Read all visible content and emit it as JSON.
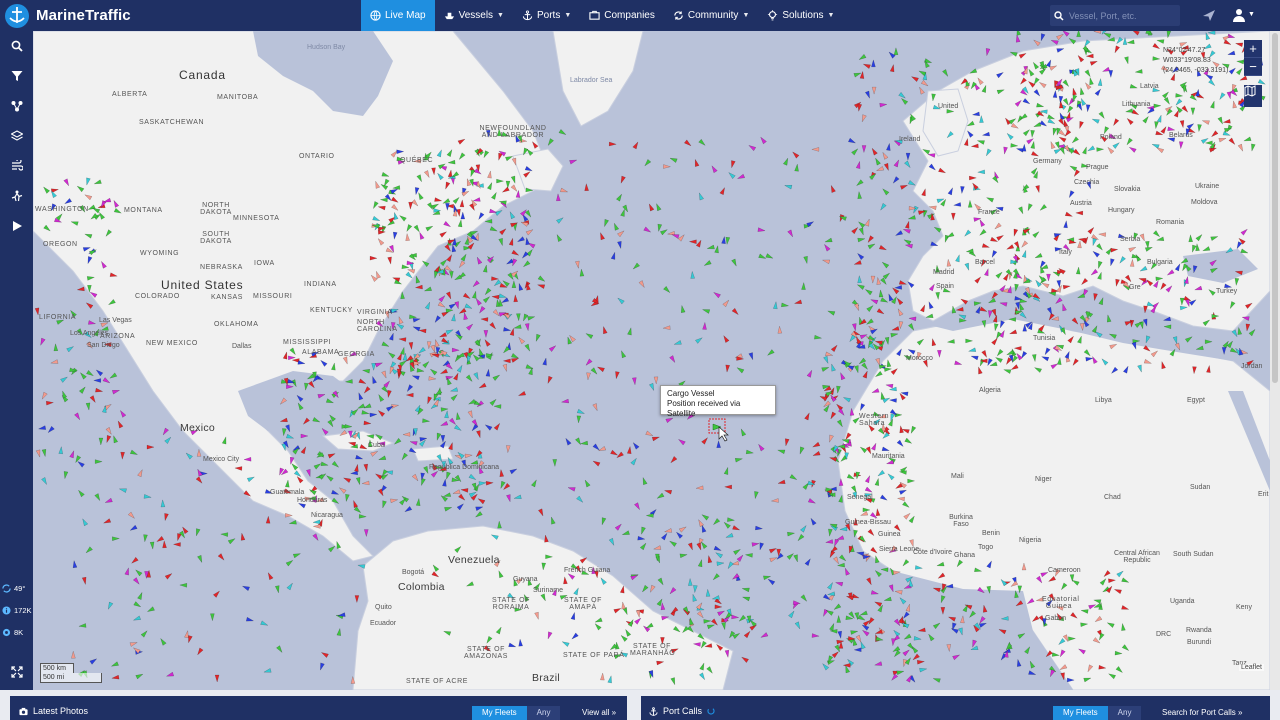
{
  "app": {
    "brand": "MarineTraffic"
  },
  "nav": {
    "items": [
      {
        "label": "Live Map",
        "icon": "globe-icon",
        "active": true,
        "caret": false
      },
      {
        "label": "Vessels",
        "icon": "ship-icon",
        "active": false,
        "caret": true
      },
      {
        "label": "Ports",
        "icon": "anchor-icon",
        "active": false,
        "caret": true
      },
      {
        "label": "Companies",
        "icon": "companies-icon",
        "active": false,
        "caret": false
      },
      {
        "label": "Community",
        "icon": "community-icon",
        "active": false,
        "caret": true
      },
      {
        "label": "Solutions",
        "icon": "bulb-icon",
        "active": false,
        "caret": true
      }
    ]
  },
  "search": {
    "placeholder": "Vessel, Port, etc."
  },
  "sidebar": {
    "tools": [
      "search-icon",
      "filter-icon",
      "share-icon",
      "layers-icon",
      "wind-icon",
      "measure-icon",
      "play-icon"
    ],
    "stats": [
      {
        "icon": "weather-icon",
        "value": "49°"
      },
      {
        "icon": "info-icon",
        "value": "172K"
      },
      {
        "icon": "settings-icon",
        "value": "8K"
      }
    ]
  },
  "map": {
    "tooltip": {
      "line1": "Cargo Vessel",
      "line2": "Position received via Satellite"
    },
    "coordinates": {
      "lat": "N24°02'47.27",
      "lon": "W033°19'08.83",
      "decimal": "(24.0465, -033.3191)"
    },
    "scale": {
      "km": "500 km",
      "mi": "500 mi"
    },
    "attribution": "Leaflet",
    "zoom_in": "+",
    "zoom_out": "−",
    "labels": {
      "canada": "Canada",
      "united_states": "United States",
      "mexico": "Mexico",
      "venezuela": "Venezuela",
      "colombia": "Colombia",
      "brazil": "Brazil",
      "guyana": "Guyana",
      "suriname": "Suriname",
      "french_guiana": "French Guiana",
      "ecuador": "Ecuador",
      "cuba": "Cuba",
      "honduras": "Honduras",
      "nicaragua": "Nicaragua",
      "guatemala": "Guatemala",
      "dominican": "República Dominicana",
      "hudson_bay": "Hudson Bay",
      "labrador_sea": "Labrador Sea",
      "alberta": "ALBERTA",
      "saskatchewan": "SASKATCHEWAN",
      "manitoba": "MANITOBA",
      "ontario": "ONTARIO",
      "quebec": "QUÉBEC",
      "newfoundland": "NEWFOUNDLAND AND LABRADOR",
      "washington": "WASHINGTON",
      "oregon": "OREGON",
      "montana": "MONTANA",
      "wyoming": "WYOMING",
      "north_dakota": "NORTH DAKOTA",
      "south_dakota": "SOUTH DAKOTA",
      "nebraska": "NEBRASKA",
      "colorado": "COLORADO",
      "kansas": "KANSAS",
      "oklahoma": "OKLAHOMA",
      "new_mexico": "NEW MEXICO",
      "minnesota": "MINNESOTA",
      "iowa": "IOWA",
      "missouri": "MISSOURI",
      "indiana": "INDIANA",
      "kentucky": "KENTUCKY",
      "virginia": "VIRGINIA",
      "north_carolina": "NORTH CAROLINA",
      "mississippi": "MISSISSIPPI",
      "alabama": "ALABAMA",
      "georgia": "GEORGIA",
      "california": "LIFORNIA",
      "los_angeles": "Los Angeles",
      "las_vegas": "Las Vegas",
      "san_diego": "San Diego",
      "arizona": "ARIZONA",
      "dallas": "Dallas",
      "mexico_city": "Mexico City",
      "bogota": "Bogotá",
      "quito": "Quito",
      "state_roraima": "STATE OF RORAIMA",
      "state_amapa": "STATE OF AMAPÁ",
      "state_amazonas": "STATE OF AMAZONAS",
      "state_para": "STATE OF PARÁ",
      "state_maranhao": "STATE OF MARANHÃO",
      "state_acre": "STATE OF ACRE",
      "united_kingdom": "United",
      "ireland": "Ireland",
      "france": "France",
      "spain": "Spain",
      "germany": "Germany",
      "poland": "Poland",
      "belarus": "Belarus",
      "lithuania": "Lithuania",
      "latvia": "Latvia",
      "ukraine": "Ukraine",
      "czechia": "Czechia",
      "austria": "Austria",
      "hungary": "Hungary",
      "slovakia": "Slovakia",
      "romania": "Romania",
      "moldova": "Moldova",
      "serbia": "Serbia",
      "bulgaria": "Bulgaria",
      "italy": "Italy",
      "greece": "Gre",
      "turkey": "Turkey",
      "tunisia": "Tunisia",
      "morocco": "Morocco",
      "algeria": "Algeria",
      "libya": "Libya",
      "egypt": "Egypt",
      "jordan": "Jordan",
      "western_sahara": "Western Sahara",
      "mauritania": "Mauritania",
      "mali": "Mali",
      "niger": "Niger",
      "chad": "Chad",
      "sudan": "Sudan",
      "south_sudan": "South Sudan",
      "eritrea": "Erit",
      "senegal": "Senegal",
      "guinea_bissau": "Guinea-Bissau",
      "guinea": "Guinea",
      "sierra_leone": "Sierra Leone",
      "cote_divoire": "Côte d'Ivoire",
      "ghana": "Ghana",
      "burkina_faso": "Burkina Faso",
      "benin": "Benin",
      "togo": "Togo",
      "nigeria": "Nigeria",
      "cameroon": "Cameroon",
      "car": "Central African Republic",
      "equatorial_guinea": "Equatorial Guinea",
      "gabon": "Gabon",
      "drc": "DRC",
      "uganda": "Uganda",
      "kenya": "Keny",
      "rwanda": "Rwanda",
      "burundi": "Burundi",
      "tanzania": "Tanz",
      "madrid": "Madrid",
      "prague": "Prague",
      "barcelona": "Barcel"
    }
  },
  "bottom": {
    "latest_photos": {
      "title": "Latest Photos",
      "my_fleets": "My Fleets",
      "any": "Any",
      "link": "View all »"
    },
    "port_calls": {
      "title": "Port Calls",
      "my_fleets": "My Fleets",
      "any": "Any",
      "link": "Search for Port Calls »"
    }
  },
  "colors": {
    "topbar": "#1f3064",
    "accent": "#1f8fe0",
    "water": "#b9c2d9",
    "land": "#f1f1f1",
    "vessel_cargo": "#3ec43e",
    "vessel_tanker": "#e0262a",
    "vessel_passenger": "#2a3fe0",
    "vessel_fishing": "#f29a8d",
    "vessel_tug": "#36c9d4",
    "vessel_pleasure": "#d02ad0"
  }
}
